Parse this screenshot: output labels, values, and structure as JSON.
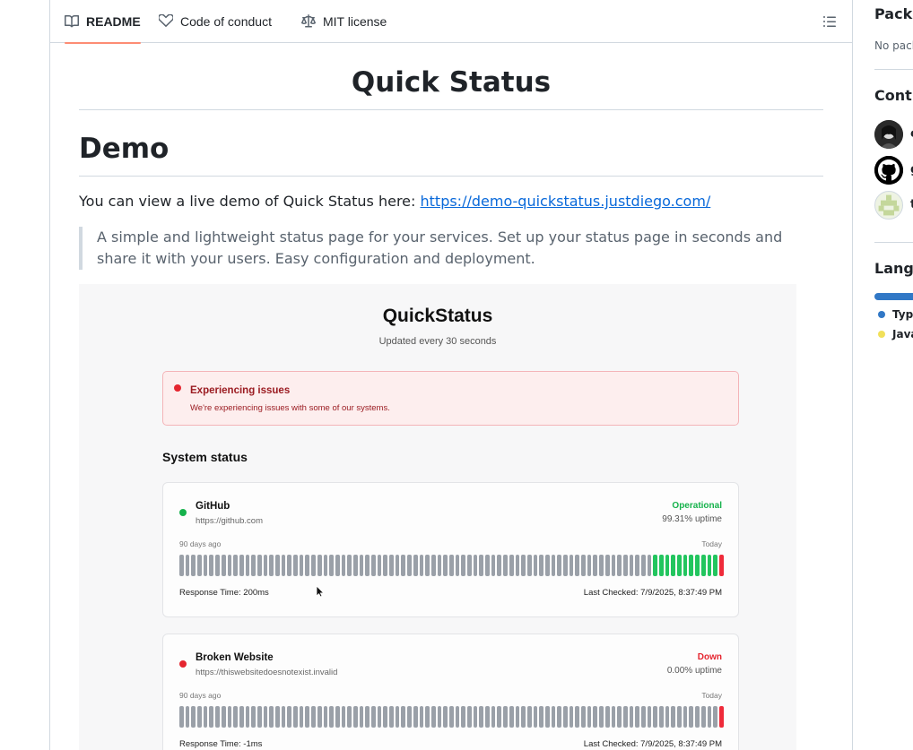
{
  "tabs": [
    {
      "label": "README",
      "icon": "book-icon",
      "active": true
    },
    {
      "label": "Code of conduct",
      "icon": "heart-handshake-icon",
      "active": false
    },
    {
      "label": "MIT license",
      "icon": "law-scale-icon",
      "active": false
    }
  ],
  "toc_icon": "list-unordered-icon",
  "readme": {
    "title": "Quick Status",
    "demo_heading": "Demo",
    "demo_text": "You can view a live demo of Quick Status here: ",
    "demo_link": "https://demo-quickstatus.justdiego.com/",
    "quote": "A simple and lightweight status page for your services. Set up your status page in seconds and share it with your users. Easy configuration and deployment."
  },
  "screenshot": {
    "app_title": "QuickStatus",
    "subtitle": "Updated every 30 seconds",
    "alert_title": "Experiencing issues",
    "alert_text": "We're experiencing issues with some of our systems.",
    "section_heading": "System status",
    "services": [
      {
        "name": "GitHub",
        "url": "https://github.com",
        "state": "Operational",
        "state_color": "#16b24c",
        "uptime": "99.31% uptime",
        "range_start": "90 days ago",
        "range_end": "Today",
        "response": "Response Time: 200ms",
        "last_checked": "Last Checked: 7/9/2025, 8:37:49 PM",
        "gray_bars": 79,
        "green_bars": 11,
        "red_bars": 1
      },
      {
        "name": "Broken Website",
        "url": "https://thiswebsitedoesnotexist.invalid",
        "state": "Down",
        "state_color": "#e5252f",
        "uptime": "0.00% uptime",
        "range_start": "90 days ago",
        "range_end": "Today",
        "response": "Response Time: -1ms",
        "last_checked": "Last Checked: 7/9/2025, 8:37:49 PM",
        "gray_bars": 90,
        "green_bars": 0,
        "red_bars": 1
      }
    ]
  },
  "sidebar": {
    "packages_heading": "Packa",
    "packages_text": "No pack",
    "contributors_heading": "Contr",
    "contributors": [
      {
        "name": "c",
        "avatar": "avatar-photo-icon"
      },
      {
        "name": "g",
        "avatar": "github-octocat-icon"
      },
      {
        "name": "t",
        "avatar": "identicon-avatar-icon"
      }
    ],
    "languages_heading": "Langu",
    "languages": [
      {
        "name": "Typ",
        "color": "#3178c6"
      },
      {
        "name": "Java",
        "color": "#f1e05a"
      }
    ]
  }
}
